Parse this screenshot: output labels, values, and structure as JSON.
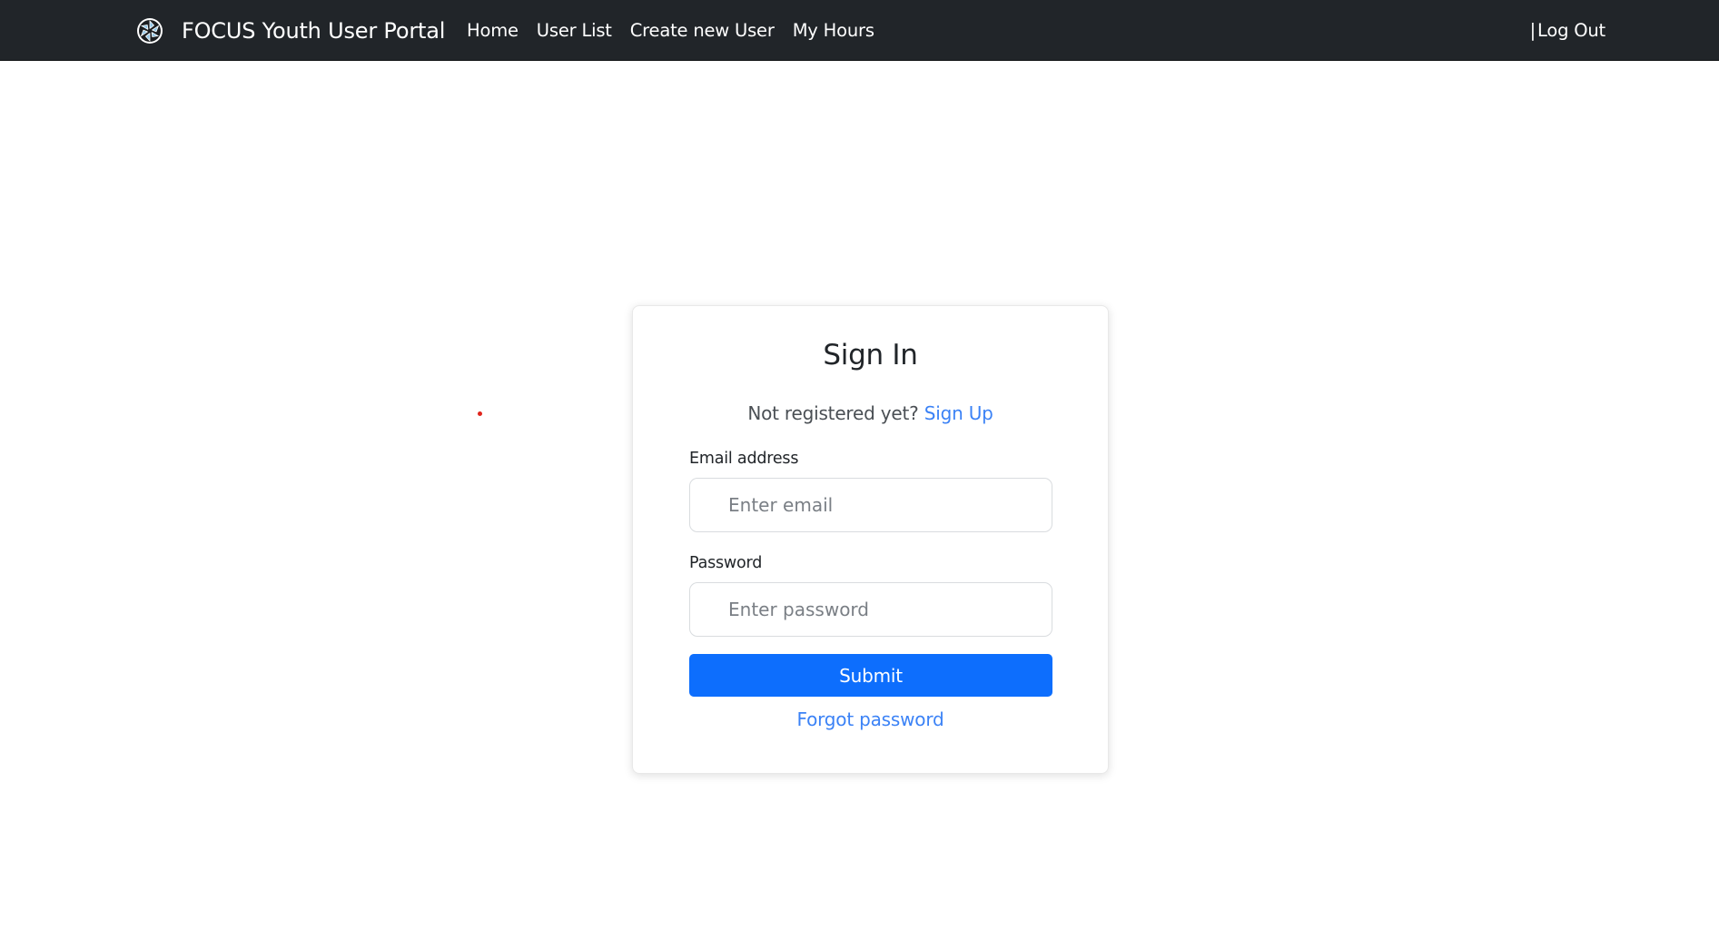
{
  "navbar": {
    "brand": "FOCUS Youth User Portal",
    "logo_icon": "aperture-logo-icon",
    "links": [
      "Home",
      "User List",
      "Create new User",
      "My Hours"
    ],
    "separator": "|",
    "logout": "Log Out"
  },
  "signin": {
    "title": "Sign In",
    "register_prompt": "Not registered yet?",
    "signup_link": "Sign Up",
    "email_label": "Email address",
    "email_placeholder": "Enter email",
    "email_value": "",
    "password_label": "Password",
    "password_placeholder": "Enter password",
    "password_value": "",
    "submit_label": "Submit",
    "forgot_link": "Forgot password"
  },
  "colors": {
    "navbar_bg": "#212529",
    "primary": "#0d6efd",
    "link": "#3b82f6",
    "marker": "#e0241c"
  }
}
